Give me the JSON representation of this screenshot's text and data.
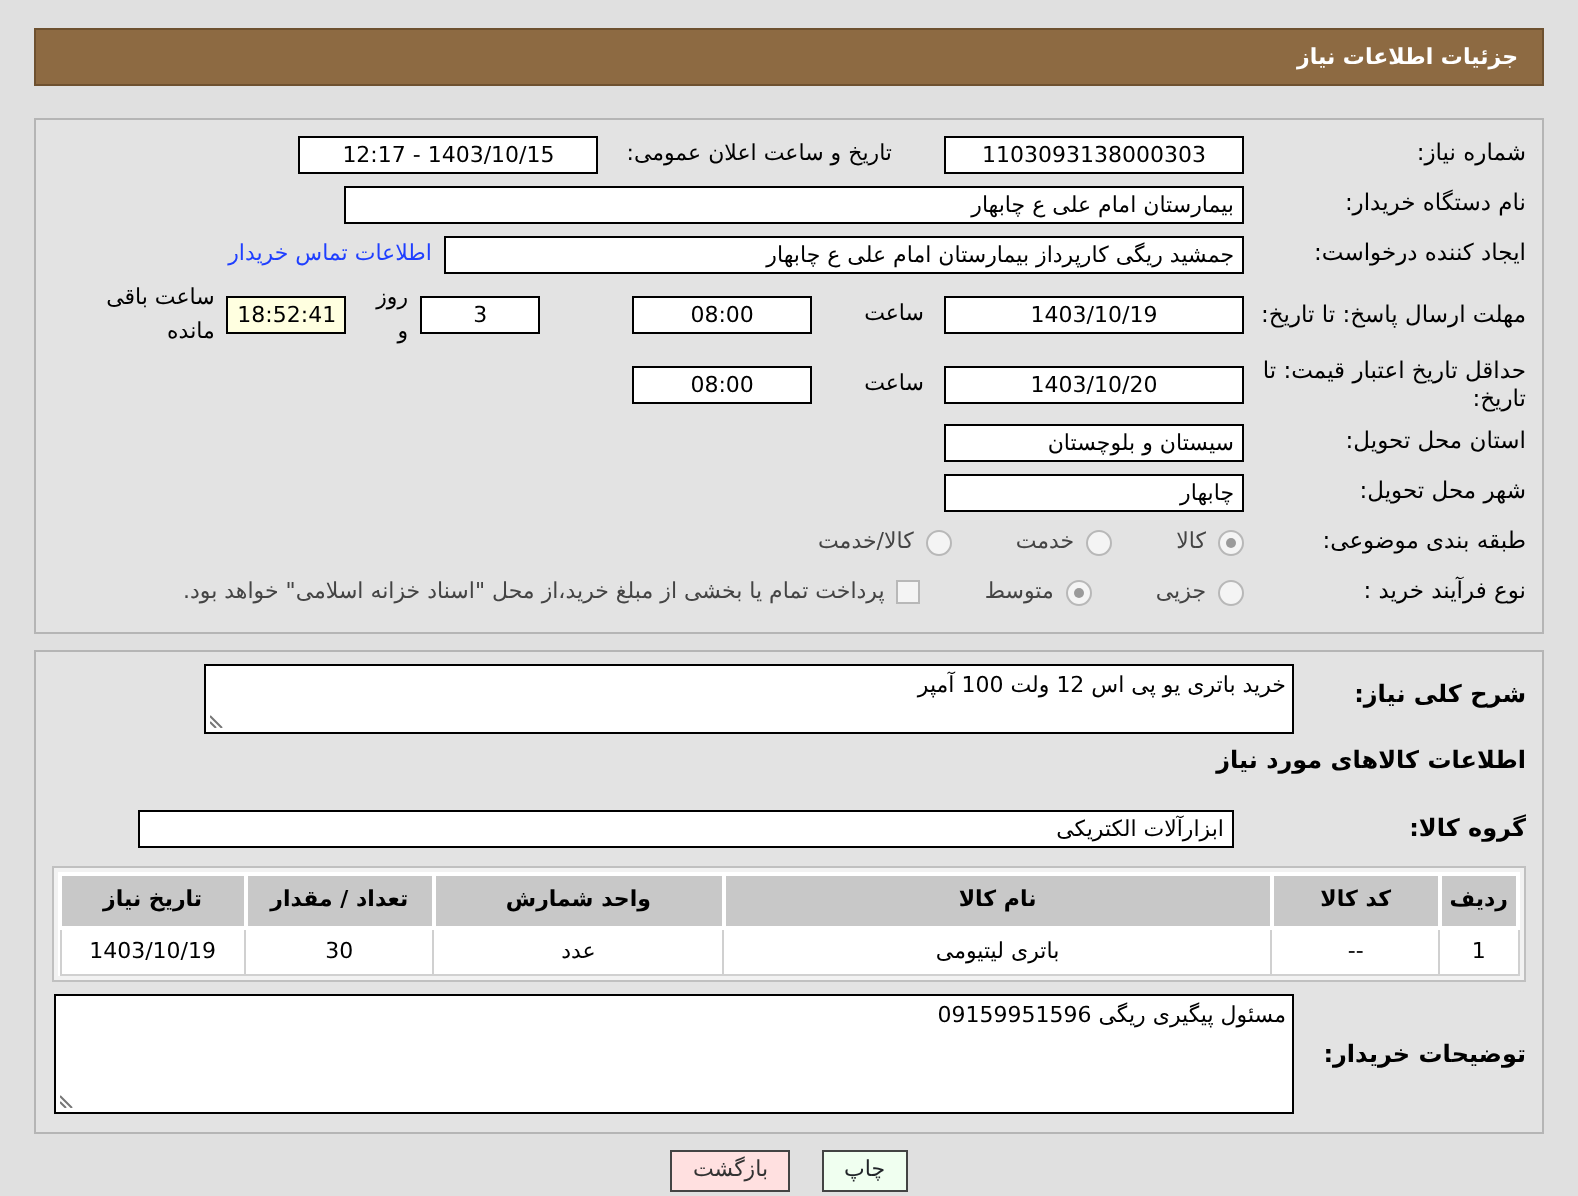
{
  "header": {
    "title": "جزئیات اطلاعات نیاز"
  },
  "details": {
    "need_number": {
      "label": "شماره نیاز:",
      "value": "1103093138000303"
    },
    "announce": {
      "label": "تاریخ و ساعت اعلان عمومی:",
      "value": "1403/10/15 - 12:17"
    },
    "buyer_org": {
      "label": "نام دستگاه خریدار:",
      "value": "بیمارستان امام علی  ع  چابهار"
    },
    "requester": {
      "label": "ایجاد کننده درخواست:",
      "value": "جمشید ریگی کارپرداز بیمارستان امام علی  ع  چابهار",
      "link": "اطلاعات تماس خریدار"
    },
    "deadline": {
      "label": "مهلت ارسال پاسخ: تا تاریخ:",
      "date": "1403/10/19",
      "time_label": "ساعت",
      "time": "08:00",
      "days": "3",
      "days_label": "روز و",
      "remaining": "18:52:41",
      "remaining_label": "ساعت باقی مانده"
    },
    "price_validity": {
      "label": "حداقل تاریخ اعتبار قیمت: تا تاریخ:",
      "date": "1403/10/20",
      "time_label": "ساعت",
      "time": "08:00"
    },
    "province": {
      "label": "استان محل تحویل:",
      "value": "سیستان و بلوچستان"
    },
    "city": {
      "label": "شهر محل تحویل:",
      "value": "چابهار"
    },
    "category": {
      "label": "طبقه بندی موضوعی:",
      "options": [
        {
          "label": "کالا",
          "selected": true
        },
        {
          "label": "خدمت",
          "selected": false
        },
        {
          "label": "کالا/خدمت",
          "selected": false
        }
      ]
    },
    "process": {
      "label": "نوع فرآیند خرید :",
      "options": [
        {
          "label": "جزیی",
          "selected": false
        },
        {
          "label": "متوسط",
          "selected": true
        }
      ],
      "checkbox": {
        "label": "پرداخت تمام یا بخشی از مبلغ خرید،از محل \"اسناد خزانه اسلامی\" خواهد بود.",
        "checked": false
      }
    }
  },
  "description": {
    "label": "شرح کلی نیاز:",
    "value": "خرید باتری یو پی اس  12 ولت 100 آمپر"
  },
  "goods_heading": "اطلاعات کالاهای مورد نیاز",
  "goods_group": {
    "label": "گروه کالا:",
    "value": "ابزارآلات الکتریکی"
  },
  "table": {
    "columns": [
      "ردیف",
      "کد کالا",
      "نام کالا",
      "واحد شمارش",
      "تعداد / مقدار",
      "تاریخ نیاز"
    ],
    "rows": [
      [
        "1",
        "--",
        "باتری لیتیومی",
        "عدد",
        "30",
        "1403/10/19"
      ]
    ]
  },
  "buyer_notes": {
    "label": "توضیحات خریدار:",
    "value": "مسئول پیگیری ریگی 09159951596"
  },
  "buttons": [
    {
      "label": "چاپ",
      "kind": "print"
    },
    {
      "label": "بازگشت",
      "kind": "back"
    }
  ]
}
